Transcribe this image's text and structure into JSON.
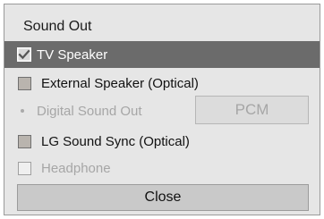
{
  "dialog": {
    "title": "Sound Out",
    "options": [
      {
        "label": "TV Speaker",
        "checked": true,
        "enabled": true
      },
      {
        "label": "External Speaker (Optical)",
        "checked": false,
        "enabled": true
      },
      {
        "label": "LG Sound Sync (Optical)",
        "checked": false,
        "enabled": true
      },
      {
        "label": "Headphone",
        "checked": false,
        "enabled": false
      }
    ],
    "digital_sound_out": {
      "label": "Digital Sound Out",
      "value": "PCM",
      "enabled": false
    },
    "close_label": "Close"
  },
  "colors": {
    "panel_bg": "#e6e6e6",
    "selected_bg": "#6b6b6b",
    "disabled_text": "#a6a6a6",
    "button_bg": "#c9c9c9"
  },
  "icons": {
    "checked": "checkbox-checked-icon",
    "unchecked": "checkbox-unchecked-icon",
    "bullet": "bullet-icon"
  }
}
